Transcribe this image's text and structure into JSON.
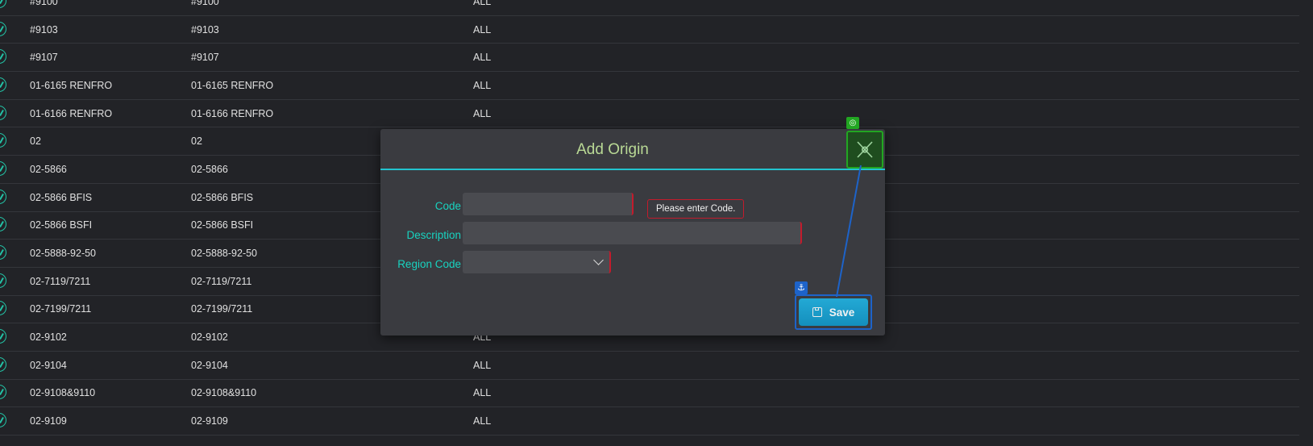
{
  "rows": [
    {
      "code": "#9100",
      "description": "#9100",
      "region": "ALL"
    },
    {
      "code": "#9103",
      "description": "#9103",
      "region": "ALL"
    },
    {
      "code": "#9107",
      "description": "#9107",
      "region": "ALL"
    },
    {
      "code": "01-6165 RENFRO",
      "description": "01-6165 RENFRO",
      "region": "ALL"
    },
    {
      "code": "01-6166 RENFRO",
      "description": "01-6166 RENFRO",
      "region": "ALL"
    },
    {
      "code": "02",
      "description": "02",
      "region": ""
    },
    {
      "code": "02-5866",
      "description": "02-5866",
      "region": ""
    },
    {
      "code": "02-5866 BFIS",
      "description": "02-5866 BFIS",
      "region": ""
    },
    {
      "code": "02-5866 BSFI",
      "description": "02-5866 BSFI",
      "region": ""
    },
    {
      "code": "02-5888-92-50",
      "description": "02-5888-92-50",
      "region": ""
    },
    {
      "code": "02-7119/7211",
      "description": "02-7119/7211",
      "region": ""
    },
    {
      "code": "02-7199/7211",
      "description": "02-7199/7211",
      "region": ""
    },
    {
      "code": "02-9102",
      "description": "02-9102",
      "region": "ALL"
    },
    {
      "code": "02-9104",
      "description": "02-9104",
      "region": "ALL"
    },
    {
      "code": "02-9108&9110",
      "description": "02-9108&9110",
      "region": "ALL"
    },
    {
      "code": "02-9109",
      "description": "02-9109",
      "region": "ALL"
    }
  ],
  "modal": {
    "title": "Add Origin",
    "code_label": "Code",
    "code_value": "",
    "code_error": "Please enter Code.",
    "description_label": "Description",
    "description_value": "",
    "region_label": "Region Code",
    "region_value": "",
    "save_label": "Save"
  },
  "icons": {
    "row_action": "edit-circle-icon",
    "dropdown": "chevron-down-icon",
    "save": "floppy-disk-icon",
    "anchor": "anchor-icon",
    "target": "crosshair-target-icon"
  },
  "colors": {
    "accent_teal": "#18d3c0",
    "title_green": "#b9d995",
    "error_red": "#c31b2c",
    "save_blue": "#1d9fcf"
  }
}
